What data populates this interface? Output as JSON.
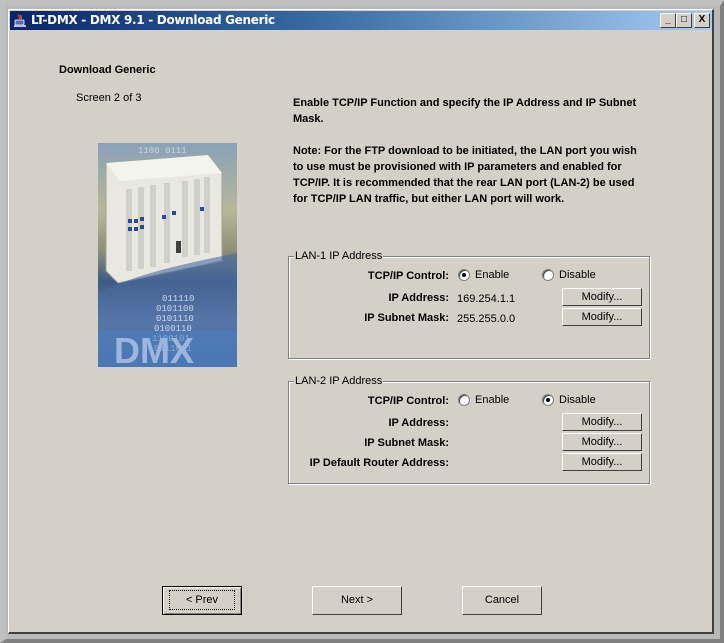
{
  "window": {
    "title": "LT-DMX - DMX 9.1 - Download Generic",
    "app_icon": "java-cup-icon",
    "controls": {
      "minimize": "_",
      "maximize": "□",
      "close": "X"
    }
  },
  "wizard": {
    "heading": "Download Generic",
    "step": "Screen 2 of 3",
    "image_caption": "DMX",
    "description": [
      "Enable TCP/IP Function and specify the IP Address and IP Subnet Mask.",
      "Note: For the FTP download to be initiated, the LAN port you wish to use must be provisioned with IP parameters and enabled for TCP/IP.  It is recommended that the rear LAN port (LAN-2) be used for TCP/IP LAN traffic, but either LAN port will work."
    ]
  },
  "lan1": {
    "title": "LAN-1 IP Address",
    "tcpip_label": "TCP/IP Control:",
    "enable_label": "Enable",
    "disable_label": "Disable",
    "selected": "Enable",
    "ip_label": "IP Address:",
    "ip_value": "169.254.1.1",
    "mask_label": "IP Subnet Mask:",
    "mask_value": "255.255.0.0",
    "modify_label": "Modify..."
  },
  "lan2": {
    "title": "LAN-2 IP Address",
    "tcpip_label": "TCP/IP Control:",
    "enable_label": "Enable",
    "disable_label": "Disable",
    "selected": "Disable",
    "ip_label": "IP Address:",
    "mask_label": "IP Subnet Mask:",
    "router_label": "IP Default Router Address:",
    "modify_label": "Modify..."
  },
  "nav": {
    "prev": "< Prev",
    "next": "Next >",
    "cancel": "Cancel"
  }
}
